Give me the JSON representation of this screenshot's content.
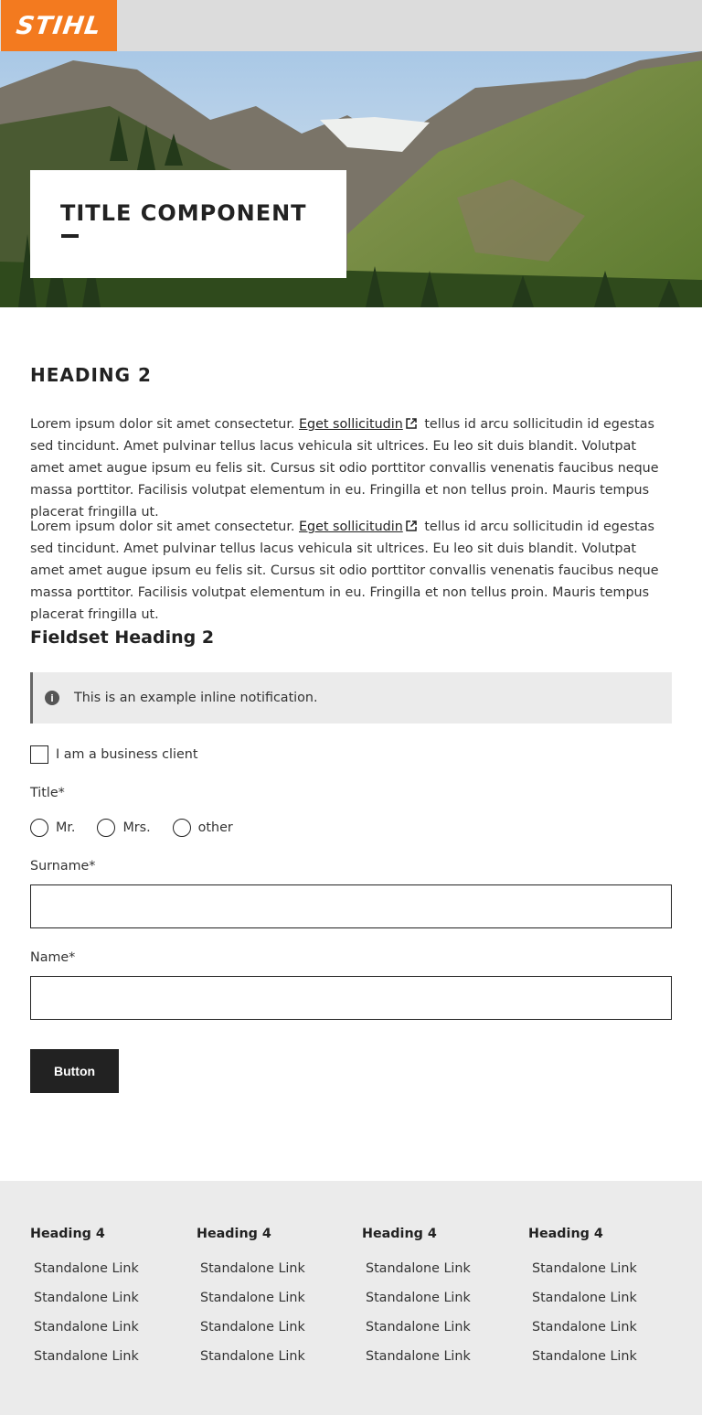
{
  "header": {
    "logo_text": "STIHL",
    "brand_color": "#f37a1f"
  },
  "hero": {
    "title": "TITLE COMPONENT"
  },
  "main": {
    "heading": "HEADING 2",
    "paragraphs": [
      {
        "before": "Lorem ipsum dolor sit amet consectetur.",
        "link": "Eget sollicitudin",
        "after": "tellus id arcu sollicitudin id egestas sed tincidunt. Amet pulvinar tellus lacus vehicula sit ultrices. Eu leo sit duis blandit. Volutpat amet amet augue ipsum eu felis sit. Cursus sit odio porttitor convallis venenatis faucibus neque massa porttitor. Facilisis volutpat elementum in eu. Fringilla et non tellus proin. Mauris tempus placerat fringilla ut."
      },
      {
        "before": "Lorem ipsum dolor sit amet consectetur.",
        "link": "Eget sollicitudin",
        "after": "tellus id arcu sollicitudin id egestas sed tincidunt. Amet pulvinar tellus lacus vehicula sit ultrices. Eu leo sit duis blandit. Volutpat amet amet augue ipsum eu felis sit. Cursus sit odio porttitor convallis venenatis faucibus neque massa porttitor. Facilisis volutpat elementum in eu. Fringilla et non tellus proin. Mauris tempus placerat fringilla ut."
      }
    ]
  },
  "form": {
    "fieldset_heading": "Fieldset Heading 2",
    "notification": "This is an example inline notification.",
    "checkbox_label": "I am a business client",
    "title_label": "Title*",
    "radios": [
      "Mr.",
      "Mrs.",
      "other"
    ],
    "surname_label": "Surname*",
    "surname_value": "",
    "name_label": "Name*",
    "name_value": "",
    "button_label": "Button"
  },
  "footer": {
    "columns": [
      {
        "heading": "Heading 4",
        "links": [
          "Standalone Link",
          "Standalone Link",
          "Standalone Link",
          "Standalone Link"
        ]
      },
      {
        "heading": "Heading 4",
        "links": [
          "Standalone Link",
          "Standalone Link",
          "Standalone Link",
          "Standalone Link"
        ]
      },
      {
        "heading": "Heading 4",
        "links": [
          "Standalone Link",
          "Standalone Link",
          "Standalone Link",
          "Standalone Link"
        ]
      },
      {
        "heading": "Heading 4",
        "links": [
          "Standalone Link",
          "Standalone Link",
          "Standalone Link",
          "Standalone Link"
        ]
      }
    ]
  }
}
